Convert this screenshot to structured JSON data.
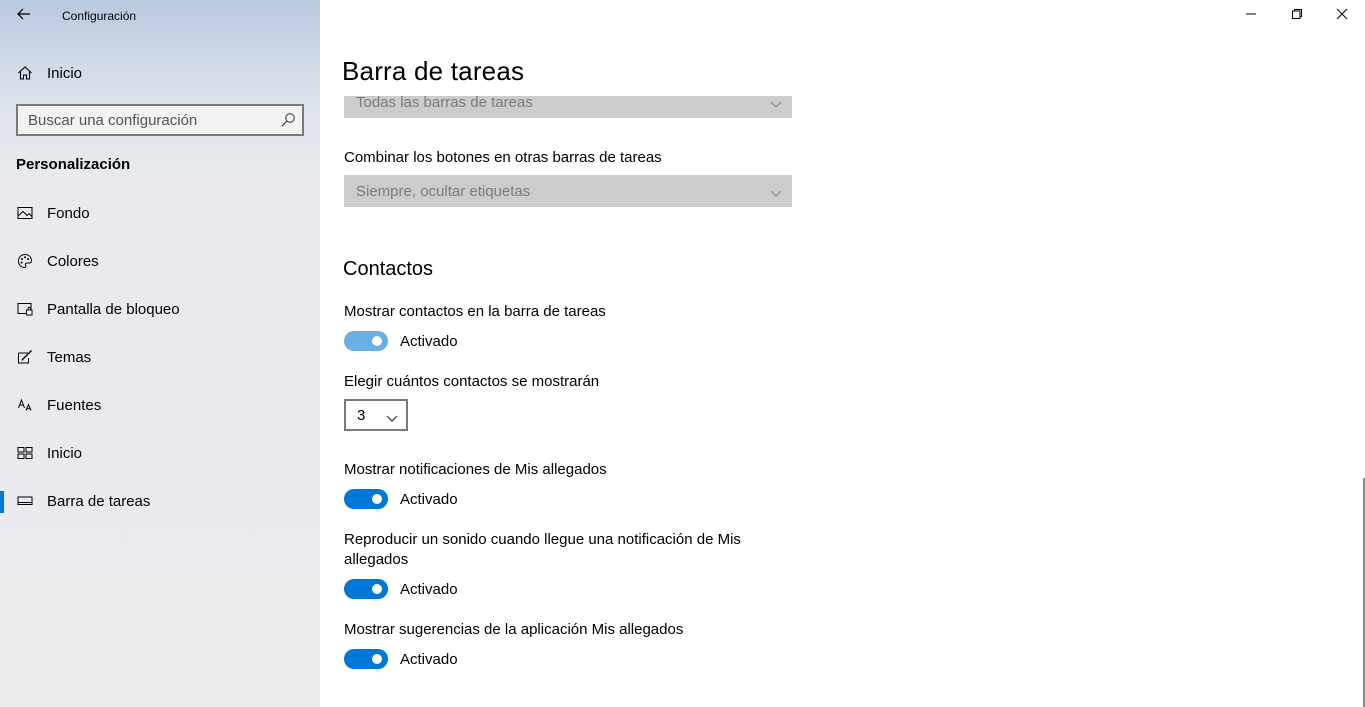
{
  "window": {
    "app_title": "Configuración",
    "controls": [
      "minimize",
      "restore",
      "close"
    ]
  },
  "sidebar": {
    "home_label": "Inicio",
    "search_placeholder": "Buscar una configuración",
    "section_heading": "Personalización",
    "items": [
      {
        "label": "Fondo",
        "icon": "image-icon"
      },
      {
        "label": "Colores",
        "icon": "palette-icon"
      },
      {
        "label": "Pantalla de bloqueo",
        "icon": "lock-screen-icon"
      },
      {
        "label": "Temas",
        "icon": "themes-icon"
      },
      {
        "label": "Fuentes",
        "icon": "fonts-icon"
      },
      {
        "label": "Inicio",
        "icon": "start-icon"
      },
      {
        "label": "Barra de tareas",
        "icon": "taskbar-icon",
        "selected": true
      }
    ],
    "accent_color": "#0078d7"
  },
  "main": {
    "page_title": "Barra de tareas",
    "dropdown_top_value": "Todas las barras de tareas",
    "combine_label": "Combinar los botones en otras barras de tareas",
    "combine_value": "Siempre, ocultar etiquetas",
    "contacts_heading": "Contactos",
    "show_contacts_label": "Mostrar contactos en la barra de tareas",
    "show_contacts_state": "Activado",
    "choose_count_label": "Elegir cuántos contactos se mostrarán",
    "choose_count_value": "3",
    "notif_label": "Mostrar notificaciones de Mis allegados",
    "notif_state": "Activado",
    "sound_label_line1": "Reproducir un sonido cuando llegue una notificación de Mis",
    "sound_label_line2": "allegados",
    "sound_state": "Activado",
    "suggest_label": "Mostrar sugerencias de la aplicación Mis allegados",
    "suggest_state": "Activado"
  }
}
